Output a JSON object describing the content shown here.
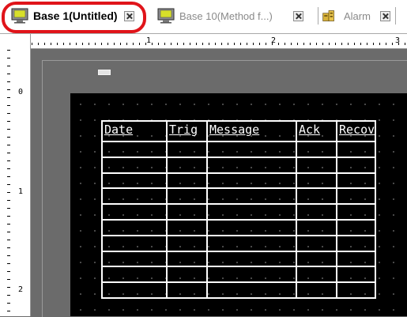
{
  "tabs": [
    {
      "label": "Base 1(Untitled)",
      "icon": "screen-icon",
      "active": true
    },
    {
      "label": "Base 10(Method f...)",
      "icon": "screen-icon",
      "active": false
    },
    {
      "label": "Alarm",
      "icon": "alarm-icon",
      "active": false
    }
  ],
  "ruler": {
    "horizontal": [
      "1",
      "2",
      "3"
    ],
    "vertical": [
      "0",
      "1",
      "2"
    ]
  },
  "alarm_table": {
    "columns": [
      "Date",
      "Trig",
      "Message",
      "Ack",
      "Recov"
    ],
    "empty_rows": 10
  },
  "colors": {
    "highlight": "#e0141a",
    "canvas": "#000000",
    "workspace": "#6b6b6b",
    "grid_line": "#ffffff"
  }
}
